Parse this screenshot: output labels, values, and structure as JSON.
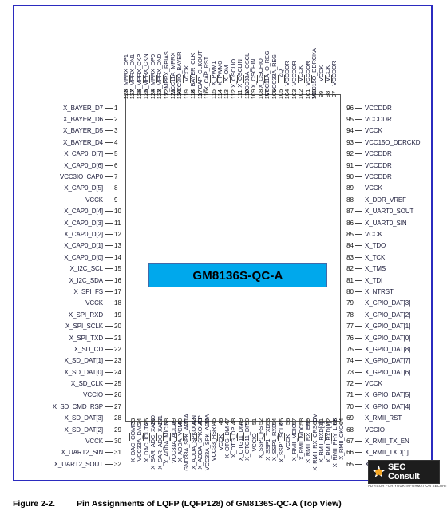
{
  "figure": {
    "number": "Figure 2-2.",
    "caption": "Pin Assignments of LQFP (LQFP128) of GM8136S-QC-A (Top View)"
  },
  "chip": {
    "part_number": "GM8136S-QC-A",
    "package": "LQFP128",
    "accent_color": "#00a8ec",
    "frame_color": "#2b2bbf"
  },
  "watermark": {
    "name": "SEC Consult",
    "tagline": "ADVISOR FOR YOUR INFORMATION SECURITY",
    "icon": "star-icon"
  },
  "pins": {
    "left": [
      {
        "num": "1",
        "name": "X_BAYER_D7"
      },
      {
        "num": "2",
        "name": "X_BAYER_D6"
      },
      {
        "num": "3",
        "name": "X_BAYER_D5"
      },
      {
        "num": "4",
        "name": "X_BAYER_D4"
      },
      {
        "num": "5",
        "name": "X_CAP0_D[7]"
      },
      {
        "num": "6",
        "name": "X_CAP0_D[6]"
      },
      {
        "num": "7",
        "name": "VCC3IO_CAP0"
      },
      {
        "num": "8",
        "name": "X_CAP0_D[5]"
      },
      {
        "num": "9",
        "name": "VCCK"
      },
      {
        "num": "10",
        "name": "X_CAP0_D[4]"
      },
      {
        "num": "11",
        "name": "X_CAP0_D[3]"
      },
      {
        "num": "12",
        "name": "X_CAP0_D[2]"
      },
      {
        "num": "13",
        "name": "X_CAP0_D[1]"
      },
      {
        "num": "14",
        "name": "X_CAP0_D[0]"
      },
      {
        "num": "15",
        "name": "X_I2C_SCL"
      },
      {
        "num": "16",
        "name": "X_I2C_SDA"
      },
      {
        "num": "17",
        "name": "X_SPI_FS"
      },
      {
        "num": "18",
        "name": "VCCK"
      },
      {
        "num": "19",
        "name": "X_SPI_RXD"
      },
      {
        "num": "20",
        "name": "X_SPI_SCLK"
      },
      {
        "num": "21",
        "name": "X_SPI_TXD"
      },
      {
        "num": "22",
        "name": "X_SD_CD"
      },
      {
        "num": "23",
        "name": "X_SD_DAT[1]"
      },
      {
        "num": "24",
        "name": "X_SD_DAT[0]"
      },
      {
        "num": "25",
        "name": "X_SD_CLK"
      },
      {
        "num": "26",
        "name": "VCCIO"
      },
      {
        "num": "27",
        "name": "X_SD_CMD_RSP"
      },
      {
        "num": "28",
        "name": "X_SD_DAT[3]"
      },
      {
        "num": "29",
        "name": "X_SD_DAT[2]"
      },
      {
        "num": "30",
        "name": "VCCK"
      },
      {
        "num": "31",
        "name": "X_UART2_SIN"
      },
      {
        "num": "32",
        "name": "X_UART2_SOUT"
      }
    ],
    "bottom": [
      {
        "num": "33",
        "name": "X_DAC_COMP"
      },
      {
        "num": "34",
        "name": "VCC33A_DAC"
      },
      {
        "num": "35",
        "name": "X_DAC_IOUTA"
      },
      {
        "num": "36",
        "name": "X_SAR_ADC_XAIN0"
      },
      {
        "num": "37",
        "name": "X_SAR_ADC_XAIN1"
      },
      {
        "num": "38",
        "name": "X_ADDA_MICIN"
      },
      {
        "num": "39",
        "name": "VCC33A_ADDA"
      },
      {
        "num": "40",
        "name": "X_ADDA_VCM"
      },
      {
        "num": "41",
        "name": "GND33A_SPK_ADDA"
      },
      {
        "num": "42",
        "name": "X_ADDA_SPKOUTN"
      },
      {
        "num": "43",
        "name": "X_ADDA_SPKOUTP"
      },
      {
        "num": "44",
        "name": "VCC33A_SPK_ADDA"
      },
      {
        "num": "45",
        "name": "VCC33_HSRT"
      },
      {
        "num": "46",
        "name": "VCCK"
      },
      {
        "num": "47",
        "name": "X_OTG_DM"
      },
      {
        "num": "48",
        "name": "X_OTG_DP"
      },
      {
        "num": "49",
        "name": "X_OTG11_DN"
      },
      {
        "num": "50",
        "name": "X_OTG11_DP"
      },
      {
        "num": "51",
        "name": "VCCIO"
      },
      {
        "num": "52",
        "name": "X_SSP1_FS"
      },
      {
        "num": "53",
        "name": "X_SSP1_TXD"
      },
      {
        "num": "54",
        "name": "X_SSP1_RXD"
      },
      {
        "num": "55",
        "name": "X_SSP1_SCLK"
      },
      {
        "num": "56",
        "name": "VCCK"
      },
      {
        "num": "57",
        "name": "X_RMII_MDIO"
      },
      {
        "num": "58",
        "name": "X_RMII_MDC"
      },
      {
        "num": "59",
        "name": "X_RMII_RX_ER"
      },
      {
        "num": "60",
        "name": "X_RMII_RX_CRS_DV"
      },
      {
        "num": "61",
        "name": "X_RMII_RXD[0]"
      },
      {
        "num": "62",
        "name": "X_RMII_RXD[1]"
      },
      {
        "num": "63",
        "name": "X_RMII_PHY_LINK"
      },
      {
        "num": "64",
        "name": "X_RMII_CKO"
      }
    ],
    "right": [
      {
        "num": "96",
        "name": "VCCDDR"
      },
      {
        "num": "95",
        "name": "VCCDDR"
      },
      {
        "num": "94",
        "name": "VCCK"
      },
      {
        "num": "93",
        "name": "VCC15O_DDRCKD"
      },
      {
        "num": "92",
        "name": "VCCDDR"
      },
      {
        "num": "91",
        "name": "VCCDDR"
      },
      {
        "num": "90",
        "name": "VCCDDR"
      },
      {
        "num": "89",
        "name": "VCCK"
      },
      {
        "num": "88",
        "name": "X_DDR_VREF"
      },
      {
        "num": "87",
        "name": "X_UART0_SOUT"
      },
      {
        "num": "86",
        "name": "X_UART0_SIN"
      },
      {
        "num": "85",
        "name": "VCCK"
      },
      {
        "num": "84",
        "name": "X_TDO"
      },
      {
        "num": "83",
        "name": "X_TCK"
      },
      {
        "num": "82",
        "name": "X_TMS"
      },
      {
        "num": "81",
        "name": "X_TDI"
      },
      {
        "num": "80",
        "name": "X_NTRST"
      },
      {
        "num": "79",
        "name": "X_GPIO_DAT[3]"
      },
      {
        "num": "78",
        "name": "X_GPIO_DAT[2]"
      },
      {
        "num": "77",
        "name": "X_GPIO_DAT[1]"
      },
      {
        "num": "76",
        "name": "X_GPIO_DAT[0]"
      },
      {
        "num": "75",
        "name": "X_GPIO_DAT[8]"
      },
      {
        "num": "74",
        "name": "X_GPIO_DAT[7]"
      },
      {
        "num": "73",
        "name": "X_GPIO_DAT[6]"
      },
      {
        "num": "72",
        "name": "VCCK"
      },
      {
        "num": "71",
        "name": "X_GPIO_DAT[5]"
      },
      {
        "num": "70",
        "name": "X_GPIO_DAT[4]"
      },
      {
        "num": "69",
        "name": "X_RMII_RST"
      },
      {
        "num": "68",
        "name": "VCCIO"
      },
      {
        "num": "67",
        "name": "X_RMII_TX_EN"
      },
      {
        "num": "66",
        "name": "X_RMII_TXD[1]"
      },
      {
        "num": "65",
        "name": "X_RMII_TXD[0]"
      }
    ],
    "top": [
      {
        "num": "128",
        "name": "X_MPRX_DP1"
      },
      {
        "num": "127",
        "name": "X_MPRX_DN1"
      },
      {
        "num": "126",
        "name": "X_MPRX_CKP"
      },
      {
        "num": "125",
        "name": "X_MPRX_CKN"
      },
      {
        "num": "124",
        "name": "X_MPRX_DP0"
      },
      {
        "num": "123",
        "name": "X_MPRX_DN0"
      },
      {
        "num": "122",
        "name": "X_MPRX_RBIAS"
      },
      {
        "num": "121",
        "name": "VCC11A_MPRX"
      },
      {
        "num": "120",
        "name": "VCC3IO_BAYER"
      },
      {
        "num": "119",
        "name": "VCCK"
      },
      {
        "num": "118",
        "name": "X_BAYER_CLK"
      },
      {
        "num": "117",
        "name": "X_CAP_CLKOUT"
      },
      {
        "num": "116",
        "name": "X_CAP_RST"
      },
      {
        "num": "115",
        "name": "X_PWM1"
      },
      {
        "num": "114",
        "name": "X_PWM0"
      },
      {
        "num": "113",
        "name": "X_OM"
      },
      {
        "num": "112",
        "name": "X_OSCLIO"
      },
      {
        "num": "111",
        "name": "X_OSCLIN"
      },
      {
        "num": "110",
        "name": "VCC33A_OSCL"
      },
      {
        "num": "109",
        "name": "X_OSCHIN"
      },
      {
        "num": "108",
        "name": "X_OSCHIO"
      },
      {
        "num": "107",
        "name": "VCC11A_O_REG"
      },
      {
        "num": "106",
        "name": "VCC33A_REG"
      },
      {
        "num": "105",
        "name": "ZQ"
      },
      {
        "num": "104",
        "name": "VCCDDR"
      },
      {
        "num": "103",
        "name": "VCCDDR"
      },
      {
        "num": "102",
        "name": "VCCK"
      },
      {
        "num": "101",
        "name": "VCCDDR"
      },
      {
        "num": "100",
        "name": "VCC15O_DDRCKA"
      },
      {
        "num": "99",
        "name": "VCCK"
      },
      {
        "num": "98",
        "name": "VCCK"
      },
      {
        "num": "97",
        "name": "VCCDDR"
      }
    ]
  }
}
